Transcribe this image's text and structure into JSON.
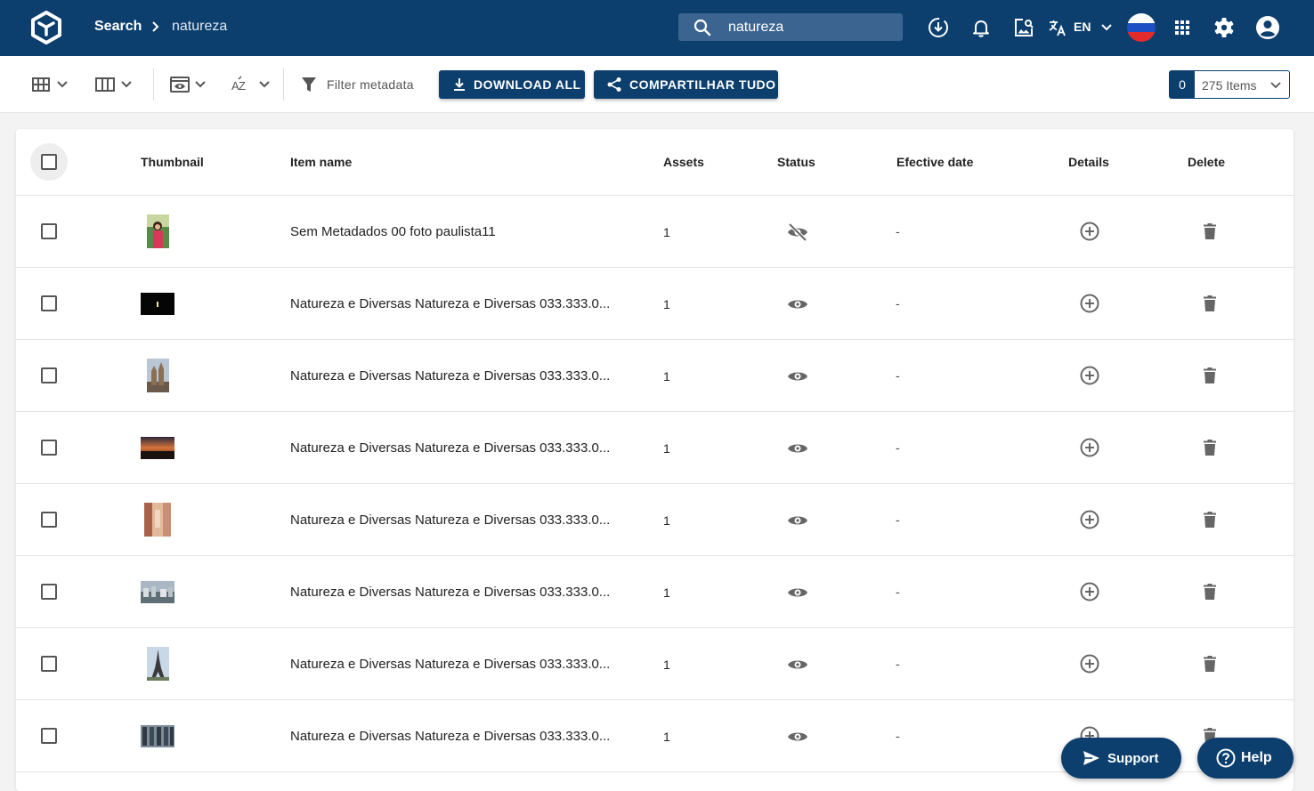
{
  "header": {
    "breadcrumb_root": "Search",
    "breadcrumb_current": "natureza",
    "search_value": "natureza",
    "language": "EN"
  },
  "toolbar": {
    "filter_label": "Filter metadata",
    "download_all": "DOWNLOAD ALL",
    "share_all": "COMPARTILHAR TUDO",
    "selected_count": "0",
    "items_label": "275 Items"
  },
  "table": {
    "columns": {
      "thumbnail": "Thumbnail",
      "item_name": "Item name",
      "assets": "Assets",
      "status": "Status",
      "date": "Efective date",
      "details": "Details",
      "delete": "Delete"
    },
    "rows": [
      {
        "name": "Sem Metadados 00 foto paulista11",
        "assets": "1",
        "status": "hidden",
        "date": "-"
      },
      {
        "name": "Natureza e Diversas Natureza e Diversas 033.333.0...",
        "assets": "1",
        "status": "visible",
        "date": "-"
      },
      {
        "name": "Natureza e Diversas Natureza e Diversas 033.333.0...",
        "assets": "1",
        "status": "visible",
        "date": "-"
      },
      {
        "name": "Natureza e Diversas Natureza e Diversas 033.333.0...",
        "assets": "1",
        "status": "visible",
        "date": "-"
      },
      {
        "name": "Natureza e Diversas Natureza e Diversas 033.333.0...",
        "assets": "1",
        "status": "visible",
        "date": "-"
      },
      {
        "name": "Natureza e Diversas Natureza e Diversas 033.333.0...",
        "assets": "1",
        "status": "visible",
        "date": "-"
      },
      {
        "name": "Natureza e Diversas Natureza e Diversas 033.333.0...",
        "assets": "1",
        "status": "visible",
        "date": "-"
      },
      {
        "name": "Natureza e Diversas Natureza e Diversas 033.333.0...",
        "assets": "1",
        "status": "visible",
        "date": "-"
      }
    ]
  },
  "floating": {
    "support": "Support",
    "help": "Help"
  },
  "colors": {
    "primary": "#0c3f6e",
    "search_bg": "#3b6590",
    "icon_gray": "#666666"
  }
}
